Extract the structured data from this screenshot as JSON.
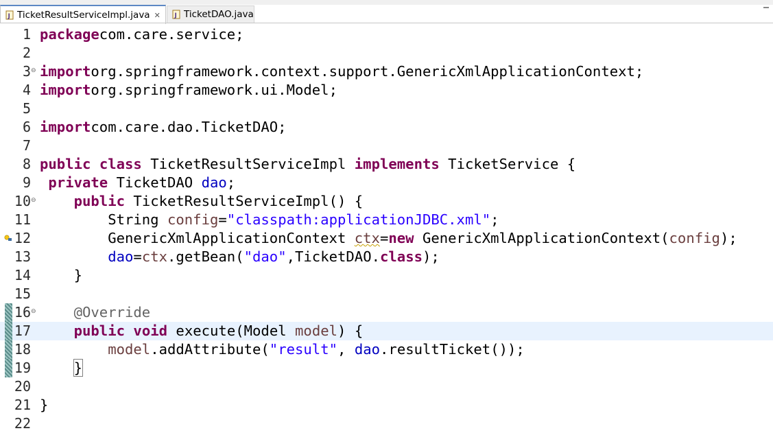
{
  "tabs": [
    {
      "label": "TicketResultServiceImpl.java",
      "close": "✕",
      "active": true
    },
    {
      "label": "TicketDAO.java",
      "active": false
    }
  ],
  "lines": [
    {
      "n": "1",
      "code": [
        [
          "kw",
          "package"
        ],
        [
          "",
          "com.care.service;"
        ]
      ]
    },
    {
      "n": "2",
      "code": []
    },
    {
      "n": "3",
      "fold": "⊖",
      "code": [
        [
          "kw",
          "import"
        ],
        [
          "",
          "org.springframework.context.support.GenericXmlApplicationContext;"
        ]
      ]
    },
    {
      "n": "4",
      "code": [
        [
          "kw",
          "import"
        ],
        [
          "",
          "org.springframework.ui.Model;"
        ]
      ]
    },
    {
      "n": "5",
      "code": []
    },
    {
      "n": "6",
      "code": [
        [
          "kw",
          "import"
        ],
        [
          "",
          "com.care.dao.TicketDAO;"
        ]
      ]
    },
    {
      "n": "7",
      "code": []
    },
    {
      "n": "8",
      "code": [
        [
          "kw",
          "public"
        ],
        [
          "",
          " "
        ],
        [
          "kw",
          "class"
        ],
        [
          "",
          " TicketResultServiceImpl "
        ],
        [
          "kw",
          "implements"
        ],
        [
          "",
          " TicketService {"
        ]
      ]
    },
    {
      "n": "9",
      "code": [
        [
          "",
          " "
        ],
        [
          "kw",
          "private"
        ],
        [
          "",
          " TicketDAO "
        ],
        [
          "fld",
          "dao"
        ],
        [
          "",
          ";"
        ]
      ]
    },
    {
      "n": "10",
      "fold": "⊖",
      "code": [
        [
          "",
          "    "
        ],
        [
          "kw",
          "public"
        ],
        [
          "",
          " TicketResultServiceImpl() {"
        ]
      ]
    },
    {
      "n": "11",
      "code": [
        [
          "",
          "        String "
        ],
        [
          "var",
          "config"
        ],
        [
          "",
          "="
        ],
        [
          "str",
          "\"classpath:applicationJDBC.xml\""
        ],
        [
          "",
          ";"
        ]
      ]
    },
    {
      "n": "12",
      "warn": true,
      "code": [
        [
          "",
          "        GenericXmlApplicationContext "
        ],
        [
          "var warn-ul",
          "ctx"
        ],
        [
          "",
          "="
        ],
        [
          "kw",
          "new"
        ],
        [
          "",
          " GenericXmlApplicationContext("
        ],
        [
          "var",
          "config"
        ],
        [
          "",
          ");"
        ]
      ]
    },
    {
      "n": "13",
      "code": [
        [
          "",
          "        "
        ],
        [
          "fld",
          "dao"
        ],
        [
          "",
          "="
        ],
        [
          "var",
          "ctx"
        ],
        [
          "",
          ".getBean("
        ],
        [
          "str",
          "\"dao\""
        ],
        [
          "",
          ",TicketDAO."
        ],
        [
          "kw",
          "class"
        ],
        [
          "",
          ");"
        ]
      ]
    },
    {
      "n": "14",
      "code": [
        [
          "",
          "    }"
        ]
      ]
    },
    {
      "n": "15",
      "code": []
    },
    {
      "n": "16",
      "fold": "⊖",
      "marker": true,
      "code": [
        [
          "",
          "    "
        ],
        [
          "ann",
          "@Override"
        ]
      ]
    },
    {
      "n": "17",
      "marker": true,
      "current": true,
      "code": [
        [
          "",
          "    "
        ],
        [
          "kw",
          "public"
        ],
        [
          "",
          " "
        ],
        [
          "kw",
          "void"
        ],
        [
          "",
          " execute(Model "
        ],
        [
          "var",
          "model"
        ],
        [
          "",
          ") {"
        ]
      ]
    },
    {
      "n": "18",
      "marker": true,
      "code": [
        [
          "",
          "        "
        ],
        [
          "var",
          "model"
        ],
        [
          "",
          ".addAttribute("
        ],
        [
          "str",
          "\"result\""
        ],
        [
          "",
          ", "
        ],
        [
          "fld",
          "dao"
        ],
        [
          "",
          ".resultTicket());"
        ]
      ]
    },
    {
      "n": "19",
      "marker": true,
      "code": [
        [
          "",
          "    "
        ],
        [
          "bracket",
          "}"
        ]
      ]
    },
    {
      "n": "20",
      "code": []
    },
    {
      "n": "21",
      "code": [
        [
          "",
          "}"
        ]
      ]
    },
    {
      "n": "22",
      "code": []
    }
  ],
  "colors": {
    "keyword": "#7f0055",
    "string": "#2a00ff",
    "field": "#0000c0",
    "local": "#6a3e3e",
    "annotation": "#646464",
    "current_line": "#e8f2fe"
  }
}
